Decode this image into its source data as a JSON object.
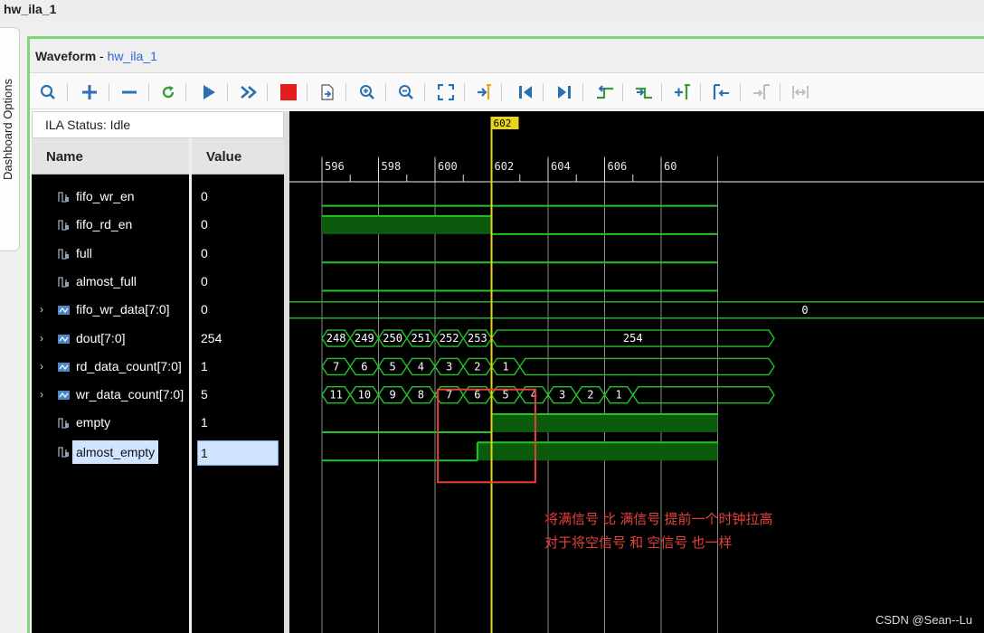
{
  "window": {
    "title": "hw_ila_1"
  },
  "dashboard": {
    "label": "Dashboard Options"
  },
  "panel": {
    "title_bold": "Waveform",
    "title_sep": " - ",
    "title_link": "hw_ila_1"
  },
  "status": {
    "text": "ILA Status:  Idle"
  },
  "columns": {
    "name": "Name",
    "value": "Value"
  },
  "signals": [
    {
      "name": "fifo_wr_en",
      "value": "0",
      "kind": "bit",
      "expandable": false
    },
    {
      "name": "fifo_rd_en",
      "value": "0",
      "kind": "bit",
      "expandable": false
    },
    {
      "name": "full",
      "value": "0",
      "kind": "bit",
      "expandable": false
    },
    {
      "name": "almost_full",
      "value": "0",
      "kind": "bit",
      "expandable": false
    },
    {
      "name": "fifo_wr_data[7:0]",
      "value": "0",
      "kind": "bus",
      "expandable": true
    },
    {
      "name": "dout[7:0]",
      "value": "254",
      "kind": "bus",
      "expandable": true
    },
    {
      "name": "rd_data_count[7:0]",
      "value": "1",
      "kind": "bus",
      "expandable": true
    },
    {
      "name": "wr_data_count[7:0]",
      "value": "5",
      "kind": "bus",
      "expandable": true
    },
    {
      "name": "empty",
      "value": "1",
      "kind": "bit",
      "expandable": false
    },
    {
      "name": "almost_empty",
      "value": "1",
      "kind": "bit",
      "expandable": false,
      "selected": true
    }
  ],
  "timeline": {
    "cursor_label": "602",
    "tick_labels": [
      "596",
      "598",
      "600",
      "602",
      "604",
      "606",
      "60"
    ]
  },
  "buses": {
    "fifo_wr_data": [
      {
        "label": "0"
      }
    ],
    "dout": [
      {
        "label": "248"
      },
      {
        "label": "249"
      },
      {
        "label": "250"
      },
      {
        "label": "251"
      },
      {
        "label": "252"
      },
      {
        "label": "253"
      },
      {
        "label": "254"
      }
    ],
    "rd_data_count": [
      {
        "label": "7"
      },
      {
        "label": "6"
      },
      {
        "label": "5"
      },
      {
        "label": "4"
      },
      {
        "label": "3"
      },
      {
        "label": "2"
      },
      {
        "label": "1"
      },
      {
        "label": ""
      }
    ],
    "wr_data_count": [
      {
        "label": "11"
      },
      {
        "label": "10"
      },
      {
        "label": "9"
      },
      {
        "label": "8"
      },
      {
        "label": "7"
      },
      {
        "label": "6"
      },
      {
        "label": "5"
      },
      {
        "label": "4"
      },
      {
        "label": "3"
      },
      {
        "label": "2"
      },
      {
        "label": "1"
      },
      {
        "label": ""
      }
    ]
  },
  "annotation": {
    "line1": "将满信号 比 满信号 提前一个时钟拉高",
    "line2": "对于将空信号 和 空信号 也一样",
    "color": "#e8403a"
  },
  "watermark": "CSDN @Sean--Lu",
  "toolbar": {
    "buttons": [
      "search-icon",
      "plus-icon",
      "minus-icon",
      "refresh-icon",
      "play-icon",
      "fast-forward-icon",
      "stop-icon",
      "export-icon",
      "zoom-in-icon",
      "zoom-out-icon",
      "zoom-fit-icon",
      "add-marker-icon",
      "go-start-icon",
      "go-end-icon",
      "prev-transition-icon",
      "next-transition-icon",
      "add-cursor-icon",
      "prev-marker-icon",
      "next-marker-icon",
      "swap-cursors-icon"
    ]
  },
  "colors": {
    "wave": "#22c42a",
    "cursor": "#e7d31c",
    "fill": "#0c5a0c",
    "grid": "#8a8a8a"
  }
}
